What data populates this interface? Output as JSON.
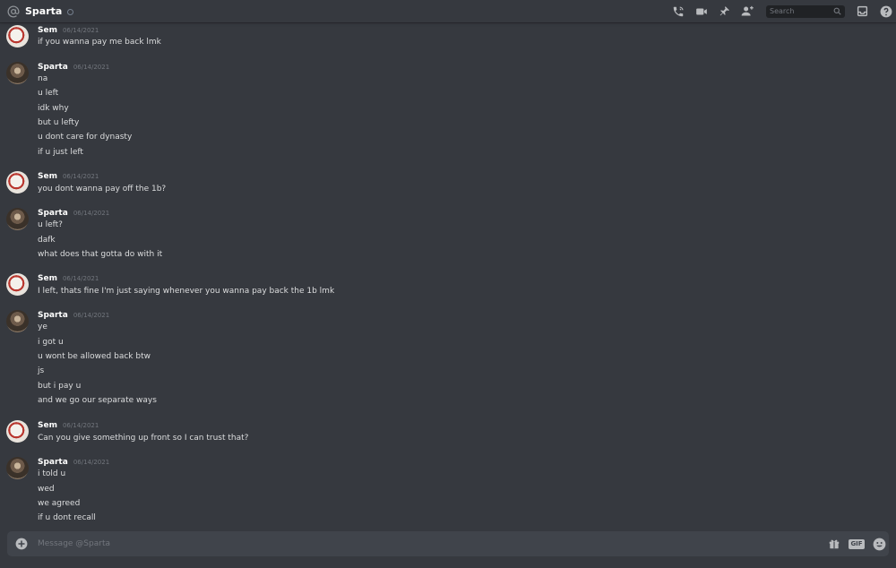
{
  "header": {
    "channel_name": "Sparta",
    "search_placeholder": "Search"
  },
  "icons": {
    "at": "at-icon",
    "status": "offline-status-icon",
    "call": "phone-call-icon",
    "video": "video-icon",
    "pin": "pin-icon",
    "add_friend": "add-friend-icon",
    "search": "search-icon",
    "inbox": "inbox-icon",
    "help": "help-icon",
    "add": "plus-circle-icon",
    "gift": "gift-icon",
    "gif": "gif-icon",
    "emoji": "emoji-icon"
  },
  "messages": [
    {
      "author": "Sem",
      "time": "06/14/2021",
      "lines": [
        "if you wanna pay me back lmk"
      ]
    },
    {
      "author": "Sparta",
      "time": "06/14/2021",
      "lines": [
        "na",
        "u left",
        "idk why",
        "but u lefty",
        "u dont care for dynasty",
        "if u just left"
      ]
    },
    {
      "author": "Sem",
      "time": "06/14/2021",
      "lines": [
        "you dont wanna pay off the 1b?"
      ]
    },
    {
      "author": "Sparta",
      "time": "06/14/2021",
      "lines": [
        "u left?",
        "dafk",
        "what does that gotta do with it"
      ]
    },
    {
      "author": "Sem",
      "time": "06/14/2021",
      "lines": [
        "I left, thats fine I'm just saying whenever you wanna pay back the 1b lmk"
      ]
    },
    {
      "author": "Sparta",
      "time": "06/14/2021",
      "lines": [
        "ye",
        "i got u",
        "u wont be allowed back btw",
        "js",
        "but i pay u",
        "and we go our separate ways"
      ]
    },
    {
      "author": "Sem",
      "time": "06/14/2021",
      "lines": [
        "Can you give something up front so I can trust that?"
      ]
    },
    {
      "author": "Sparta",
      "time": "06/14/2021",
      "lines": [
        "i told u",
        "wed",
        "we agreed",
        "if u dont recall"
      ]
    }
  ],
  "composer": {
    "placeholder": "Message @Sparta",
    "gif_label": "GIF"
  },
  "colors": {
    "background": "#36393f",
    "composer": "#40444b",
    "text": "#dcddde",
    "muted": "#72767d"
  }
}
